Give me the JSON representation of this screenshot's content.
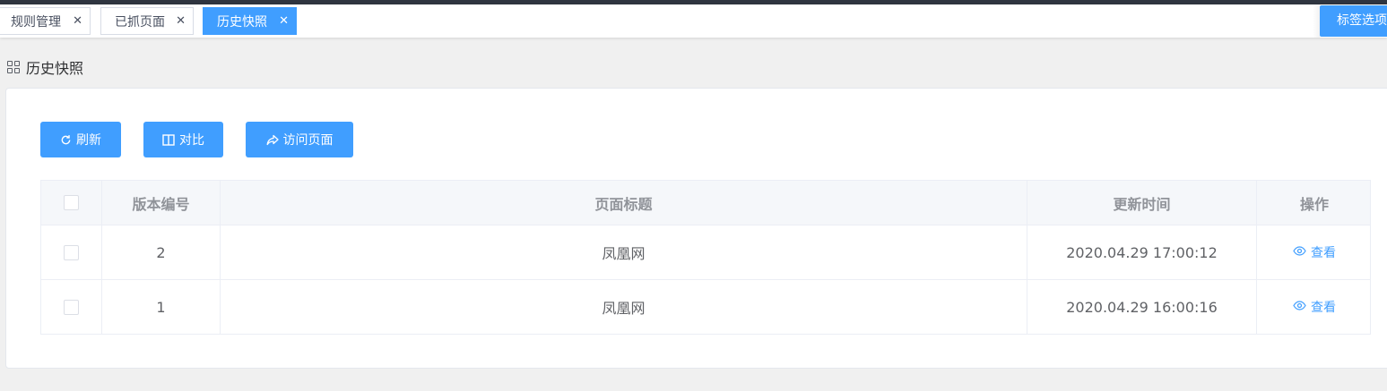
{
  "tabs": [
    {
      "label": "规则管理",
      "active": false
    },
    {
      "label": "已抓页面",
      "active": false
    },
    {
      "label": "历史快照",
      "active": true
    }
  ],
  "tag_options_label": "标签选项",
  "page_title": "历史快照",
  "toolbar": {
    "refresh_label": "刷新",
    "compare_label": "对比",
    "visit_label": "访问页面"
  },
  "table": {
    "headers": {
      "version": "版本编号",
      "title": "页面标题",
      "updated": "更新时间",
      "actions": "操作"
    },
    "rows": [
      {
        "version": "2",
        "title": "凤凰网",
        "updated": "2020.04.29 17:00:12",
        "action": "查看"
      },
      {
        "version": "1",
        "title": "凤凰网",
        "updated": "2020.04.29 16:00:16",
        "action": "查看"
      }
    ]
  },
  "colors": {
    "primary": "#409eff",
    "topbar": "#2f3540"
  }
}
